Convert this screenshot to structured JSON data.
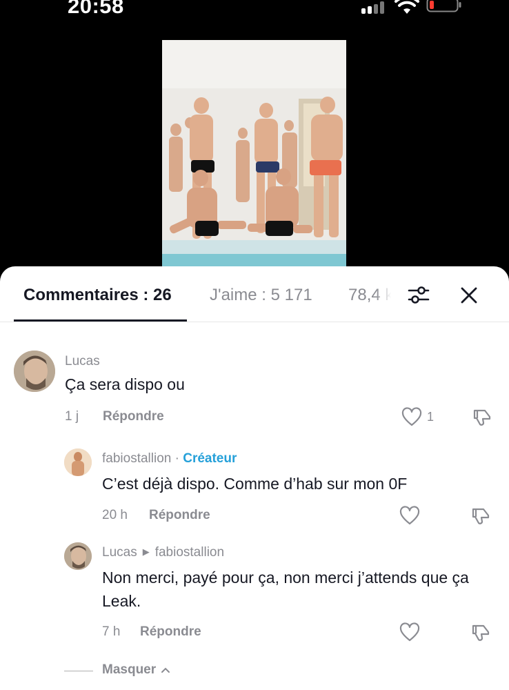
{
  "status_bar": {
    "time": "20:58"
  },
  "video": {
    "description": ""
  },
  "tabs": {
    "comments": "Commentaires : 26",
    "likes": "J'aime : 5 171",
    "views": "78,4 k"
  },
  "icons": {
    "filter": "sliders-icon",
    "close": "close-icon",
    "like": "heart-outline-icon",
    "dislike": "thumbs-down-icon"
  },
  "colors": {
    "creator_tag": "#25a0d9",
    "muted_text": "#8a8b91",
    "primary_text": "#161823"
  },
  "comments": [
    {
      "username": "Lucas",
      "text": "Ça sera dispo ou",
      "time": "1 j",
      "reply_label": "Répondre",
      "likes": "1"
    },
    {
      "username": "fabiostallion",
      "separator": "·",
      "creator_label": "Créateur",
      "text": "C’est déjà dispo. Comme d’hab sur mon 0F",
      "time": "20 h",
      "reply_label": "Répondre"
    },
    {
      "username": "Lucas",
      "reply_to": "fabiostallion",
      "text": "Non merci, payé pour ça, non merci j’attends que ça Leak.",
      "time": "7 h",
      "reply_label": "Répondre"
    }
  ],
  "hide_replies": "Masquer"
}
